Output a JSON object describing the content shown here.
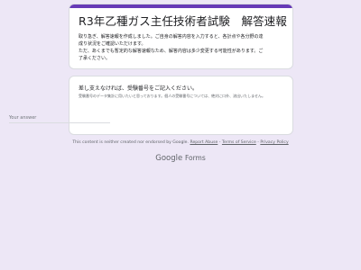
{
  "form": {
    "title": "R3年乙種ガス主任技術者試験　解答速報",
    "description_lines": [
      "取り急ぎ、解答速報を作成しました。ご自身の解答内容を入力すると、各計点や各分野の達",
      "成り状況をご確認いただけます。",
      "ただ、あくまでも暫定的な解答速報なため、解答内容は多少変更する可能性があります。ご",
      "了承ください。"
    ]
  },
  "question": {
    "title": "差し支えなければ、受験番号をご記入ください。",
    "description": "受験番号のデータ集計に用いたいと思っております。個人の受験番号については、絶対に口外、流出いたしません。",
    "answer_placeholder": "Your answer"
  },
  "footer": {
    "disclaimer": "This content is neither created nor endorsed by Google.",
    "report_abuse": "Report Abuse",
    "terms": "Terms of Service",
    "privacy": "Privacy Policy",
    "separator": " - "
  },
  "logo": {
    "google": "Google",
    "forms": "Forms"
  },
  "colors": {
    "accent": "#673ab7",
    "background": "#ede7f6"
  }
}
